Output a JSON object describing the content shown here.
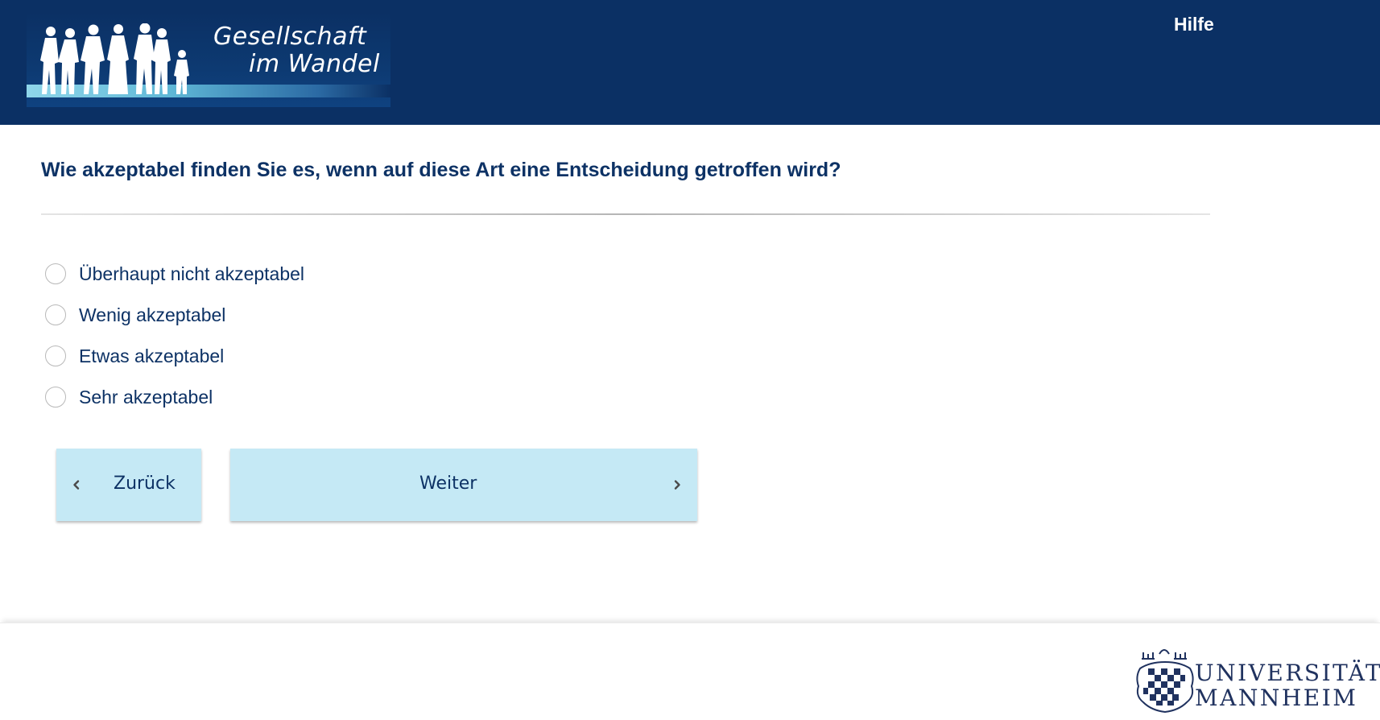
{
  "header": {
    "logo": {
      "line1": "Gesellschaft",
      "line2": "im Wandel"
    },
    "help_label": "Hilfe"
  },
  "question": {
    "text": "Wie akzeptabel finden Sie es, wenn auf diese Art eine Entscheidung getroffen wird?",
    "options": [
      {
        "label": "Überhaupt nicht akzeptabel",
        "selected": false
      },
      {
        "label": "Wenig akzeptabel",
        "selected": false
      },
      {
        "label": "Etwas akzeptabel",
        "selected": false
      },
      {
        "label": "Sehr akzeptabel",
        "selected": false
      }
    ]
  },
  "navigation": {
    "back_label": "Zurück",
    "next_label": "Weiter",
    "back_icon": "chevron-left-icon",
    "next_icon": "chevron-right-icon"
  },
  "footer": {
    "university": {
      "line1": "UNIVERSITÄT",
      "line2": "MANNHEIM"
    }
  },
  "colors": {
    "header_bg": "#0b3064",
    "text": "#0d3265",
    "button_bg": "#c5e9f5",
    "radio_border": "#b9b9b9"
  }
}
